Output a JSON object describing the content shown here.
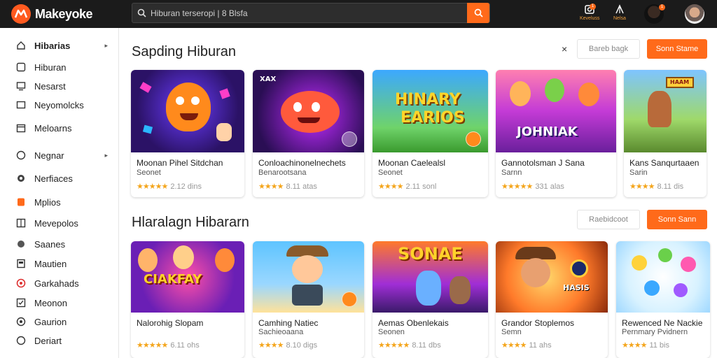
{
  "app": {
    "brand": "Makeyoke",
    "search_placeholder": "Hiburan terseropi  |  8 Blsfa",
    "top_actions": [
      {
        "label": "Keveluss",
        "icon": "download-icon",
        "badge": "1"
      },
      {
        "label": "Nelsa",
        "icon": "tent-icon",
        "badge": ""
      }
    ],
    "avatar_badge": "1"
  },
  "sidebar": {
    "items": [
      {
        "label": "Hibarias",
        "icon": "home-icon",
        "expandable": true
      },
      {
        "label": "Hiburan",
        "icon": "gamepad-icon"
      },
      {
        "label": "Nesarst",
        "icon": "monitor-icon"
      },
      {
        "label": "Neyomolcks",
        "icon": "tv-icon"
      },
      {
        "label": "Meloarns",
        "icon": "calendar-icon"
      },
      {
        "label": "Negnar",
        "icon": "bell-icon",
        "expandable": true
      },
      {
        "label": "Nerfiaces",
        "icon": "circle-icon"
      },
      {
        "label": "Mplios",
        "icon": "flame-icon"
      },
      {
        "label": "Mevepolos",
        "icon": "grid-icon"
      },
      {
        "label": "Saanes",
        "icon": "shield-icon"
      },
      {
        "label": "Mautien",
        "icon": "bookmark-icon"
      },
      {
        "label": "Garkahads",
        "icon": "globe-icon"
      },
      {
        "label": "Meonon",
        "icon": "check-box-icon"
      },
      {
        "label": "Gaurion",
        "icon": "dot-icon"
      },
      {
        "label": "Deriart",
        "icon": "pin-icon"
      }
    ]
  },
  "sections": [
    {
      "title": "Sapding Hiburan",
      "close_symbol": "×",
      "outline_button": "Bareb bagk",
      "primary_button": "Sonn Stame",
      "cards": [
        {
          "title": "Moonan Pihel Sitdchan",
          "subtitle": "Seonet",
          "rating": "★★★★★",
          "meta": "2.12 dins",
          "art": "monster-art"
        },
        {
          "title": "Conloachinonelnechets",
          "subtitle": "Benarootsana",
          "rating": "★★★★",
          "meta": "8.11 atas",
          "art": "fish-art"
        },
        {
          "title": "Moonan Caelealsl",
          "subtitle": "Seonet",
          "rating": "★★★★",
          "meta": "2.11 sonl",
          "art": "title-art"
        },
        {
          "title": "Gannotolsman J Sana",
          "subtitle": "Sarnn",
          "rating": "★★★★★",
          "meta": "331 alas",
          "art": "party-art"
        },
        {
          "title": "Kans Sanqurtaaen",
          "subtitle": "Sarin",
          "rating": "★★★★",
          "meta": "8.11 dis",
          "art": "adventure-art"
        }
      ]
    },
    {
      "title": "Hlaralagn Hibararn",
      "outline_button": "Raebidcoot",
      "primary_button": "Sonn Sann",
      "cards": [
        {
          "title": "Nalorohig Slopam",
          "subtitle": "",
          "rating": "★★★★★",
          "meta": "6.11 ohs",
          "art": "crafty-art"
        },
        {
          "title": "Camhing Natiec",
          "subtitle": "Sachieoaana",
          "rating": "★★★★",
          "meta": "8.10 digs",
          "art": "camera-art"
        },
        {
          "title": "Aemas Obenlekais",
          "subtitle": "Seonen",
          "rating": "★★★★★",
          "meta": "8.11 dbs",
          "art": "some-art"
        },
        {
          "title": "Grandor Stoplemos",
          "subtitle": "Semn",
          "rating": "★★★★",
          "meta": "11 ahs",
          "art": "cowboy-art"
        },
        {
          "title": "Rewenced Ne Nackie",
          "subtitle": "Pernmary Pvidnern",
          "rating": "★★★★",
          "meta": "11 bis",
          "art": "bubble-art"
        }
      ]
    }
  ],
  "art_text": {
    "fish_tag": "XAX",
    "title_line1": "HINARY",
    "title_line2": "EARIOS",
    "party_word": "JOHNIAK",
    "adventure_sign": "HAAM",
    "crafty_word": "CIAKFAY",
    "some_word": "SONAE",
    "cowboy_sign": "HASIS"
  },
  "colors": {
    "accent": "#ff6a1a",
    "topbar": "#1b1b1b",
    "star": "#f4a51c"
  }
}
